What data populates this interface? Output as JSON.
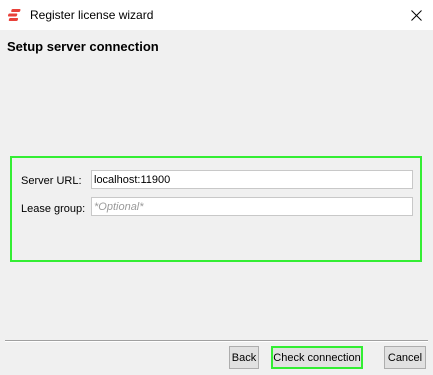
{
  "window": {
    "title": "Register license wizard",
    "app_icon": "app-logo-icon",
    "close_icon": "close-icon"
  },
  "page": {
    "heading": "Setup server connection"
  },
  "form": {
    "server_url_label": "Server URL:",
    "server_url_value": "localhost:11900",
    "lease_group_label": "Lease group:",
    "lease_group_placeholder": "*Optional*",
    "highlight_color": "#33ee33"
  },
  "buttons": {
    "back": "Back",
    "check_connection": "Check connection",
    "cancel": "Cancel"
  }
}
